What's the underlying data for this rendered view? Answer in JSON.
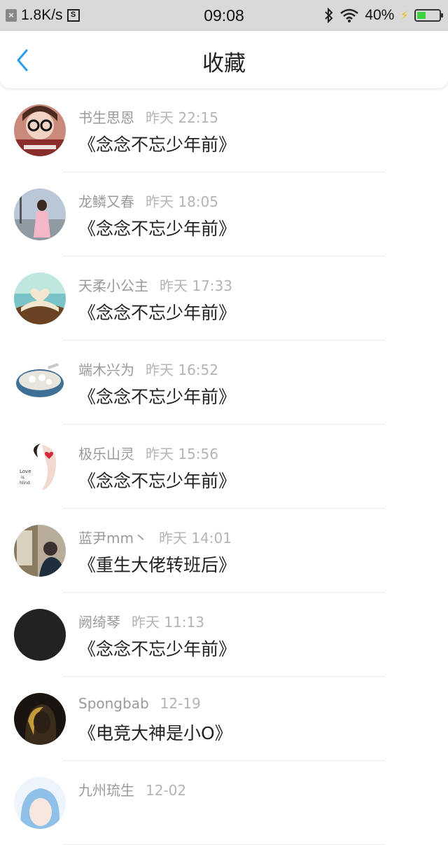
{
  "status_bar": {
    "net_speed": "1.8K/s",
    "time": "09:08",
    "battery": "40%",
    "battery_level": 0.4,
    "left_icons": [
      "close-box-icon",
      "sim-icon"
    ],
    "right_icons": [
      "bluetooth-icon",
      "wifi-icon",
      "charging-bolt-icon",
      "battery-icon"
    ]
  },
  "nav": {
    "title": "收藏",
    "back_icon": "chevron-left-icon",
    "accent_color": "#2a9df4"
  },
  "items": [
    {
      "name": "书生思恩",
      "time": "昨天 22:15",
      "title": "《念念不忘少年前》",
      "avatar": "girl-glasses"
    },
    {
      "name": "龙鳞又春",
      "time": "昨天 18:05",
      "title": "《念念不忘少年前》",
      "avatar": "girl-street"
    },
    {
      "name": "天柔小公主",
      "time": "昨天 17:33",
      "title": "《念念不忘少年前》",
      "avatar": "book-heart"
    },
    {
      "name": "端木兴为",
      "time": "昨天 16:52",
      "title": "《念念不忘少年前》",
      "avatar": "bowl"
    },
    {
      "name": "极乐山灵",
      "time": "昨天 15:56",
      "title": "《念念不忘少年前》",
      "avatar": "love-drawing"
    },
    {
      "name": "蓝尹mm丶",
      "time": "昨天 14:01",
      "title": "《重生大佬转班后》",
      "avatar": "man-street"
    },
    {
      "name": "阙绮琴",
      "time": "昨天 11:13",
      "title": "《念念不忘少年前》",
      "avatar": "black"
    },
    {
      "name": "Spongbab",
      "time": "12-19",
      "title": "《电竞大神是小O》",
      "avatar": "dark-portrait"
    },
    {
      "name": "九州琉生",
      "time": "12-02",
      "title": "",
      "avatar": "anime-blue"
    }
  ]
}
